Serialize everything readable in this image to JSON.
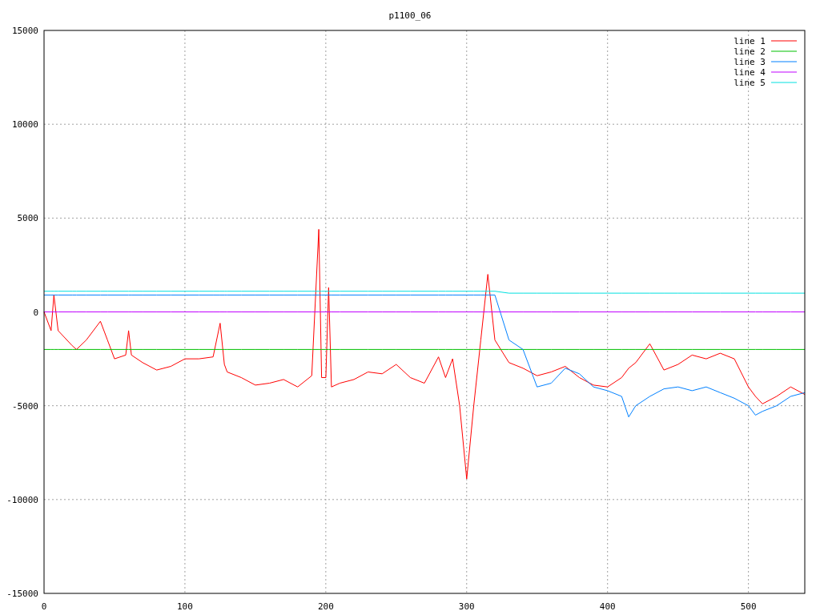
{
  "chart_data": {
    "type": "line",
    "title": "p1100_06",
    "x": [
      0,
      5,
      7,
      10,
      20,
      23,
      30,
      40,
      45,
      50,
      58,
      60,
      62,
      70,
      80,
      90,
      100,
      110,
      120,
      125,
      128,
      130,
      140,
      150,
      160,
      170,
      180,
      190,
      195,
      197,
      200,
      202,
      204,
      210,
      220,
      230,
      240,
      250,
      260,
      270,
      280,
      285,
      290,
      295,
      300,
      305,
      310,
      315,
      320,
      330,
      340,
      350,
      360,
      370,
      380,
      390,
      400,
      410,
      415,
      420,
      430,
      440,
      450,
      460,
      470,
      480,
      490,
      500,
      505,
      510,
      520,
      530,
      540
    ],
    "grid": true,
    "legend": true,
    "xlim": [
      0,
      540
    ],
    "ylim": [
      -15000,
      15000
    ],
    "xticks": [
      0,
      100,
      200,
      300,
      400,
      500
    ],
    "yticks": [
      -15000,
      -10000,
      -5000,
      0,
      5000,
      10000,
      15000
    ],
    "series": [
      {
        "name": "line 1",
        "color": "#ff0000",
        "values": [
          0,
          -1000,
          900,
          -1000,
          -1800,
          -2000,
          -1500,
          -500,
          -1500,
          -2500,
          -2300,
          -1000,
          -2300,
          -2700,
          -3100,
          -2900,
          -2500,
          -2500,
          -2400,
          -600,
          -2800,
          -3200,
          -3500,
          -3900,
          -3800,
          -3600,
          -4000,
          -3400,
          4400,
          -3500,
          -3500,
          1300,
          -4000,
          -3800,
          -3600,
          -3200,
          -3300,
          -2800,
          -3500,
          -3800,
          -2400,
          -3500,
          -2500,
          -5000,
          -8900,
          -5000,
          -1500,
          2000,
          -1500,
          -2700,
          -3000,
          -3400,
          -3200,
          -2900,
          -3500,
          -3900,
          -4000,
          -3500,
          -3000,
          -2700,
          -1700,
          -3100,
          -2800,
          -2300,
          -2500,
          -2200,
          -2500,
          -4000,
          -4500,
          -4900,
          -4500,
          -4000,
          -4400
        ]
      },
      {
        "name": "line 2",
        "color": "#00c000",
        "values": [
          -2000,
          -2000,
          -2000,
          -2000,
          -2000,
          -2000,
          -2000,
          -2000,
          -2000,
          -2000,
          -2000,
          -2000,
          -2000,
          -2000,
          -2000,
          -2000,
          -2000,
          -2000,
          -2000,
          -2000,
          -2000,
          -2000,
          -2000,
          -2000,
          -2000,
          -2000,
          -2000,
          -2000,
          -2000,
          -2000,
          -2000,
          -2000,
          -2000,
          -2000,
          -2000,
          -2000,
          -2000,
          -2000,
          -2000,
          -2000,
          -2000,
          -2000,
          -2000,
          -2000,
          -2000,
          -2000,
          -2000,
          -2000,
          -2000,
          -2000,
          -2000,
          -2000,
          -2000,
          -2000,
          -2000,
          -2000,
          -2000,
          -2000,
          -2000,
          -2000,
          -2000,
          -2000,
          -2000,
          -2000,
          -2000,
          -2000,
          -2000,
          -2000,
          -2000,
          -2000,
          -2000,
          -2000,
          -2000
        ]
      },
      {
        "name": "line 3",
        "color": "#0080ff",
        "values": [
          900,
          900,
          900,
          900,
          900,
          900,
          900,
          900,
          900,
          900,
          900,
          900,
          900,
          900,
          900,
          900,
          900,
          900,
          900,
          900,
          900,
          900,
          900,
          900,
          900,
          900,
          900,
          900,
          900,
          900,
          900,
          900,
          900,
          900,
          900,
          900,
          900,
          900,
          900,
          900,
          900,
          900,
          900,
          900,
          900,
          900,
          900,
          900,
          900,
          -1500,
          -2000,
          -4000,
          -3800,
          -3000,
          -3300,
          -4000,
          -4200,
          -4500,
          -5600,
          -5000,
          -4500,
          -4100,
          -4000,
          -4200,
          -4000,
          -4300,
          -4600,
          -5000,
          -5500,
          -5300,
          -5000,
          -4500,
          -4300
        ]
      },
      {
        "name": "line 4",
        "color": "#c000ff",
        "values": [
          0,
          0,
          0,
          0,
          0,
          0,
          0,
          0,
          0,
          0,
          0,
          0,
          0,
          0,
          0,
          0,
          0,
          0,
          0,
          0,
          0,
          0,
          0,
          0,
          0,
          0,
          0,
          0,
          0,
          0,
          0,
          0,
          0,
          0,
          0,
          0,
          0,
          0,
          0,
          0,
          0,
          0,
          0,
          0,
          0,
          0,
          0,
          0,
          0,
          0,
          0,
          0,
          0,
          0,
          0,
          0,
          0,
          0,
          0,
          0,
          0,
          0,
          0,
          0,
          0,
          0,
          0,
          0,
          0,
          0,
          0,
          0,
          0
        ]
      },
      {
        "name": "line 5",
        "color": "#00e0e0",
        "values": [
          1100,
          1100,
          1100,
          1100,
          1100,
          1100,
          1100,
          1100,
          1100,
          1100,
          1100,
          1100,
          1100,
          1100,
          1100,
          1100,
          1100,
          1100,
          1100,
          1100,
          1100,
          1100,
          1100,
          1100,
          1100,
          1100,
          1100,
          1100,
          1100,
          1100,
          1100,
          1100,
          1100,
          1100,
          1100,
          1100,
          1100,
          1100,
          1100,
          1100,
          1100,
          1100,
          1100,
          1100,
          1100,
          1100,
          1100,
          1100,
          1100,
          1000,
          1000,
          1000,
          1000,
          1000,
          1000,
          1000,
          1000,
          1000,
          1000,
          1000,
          1000,
          1000,
          1000,
          1000,
          1000,
          1000,
          1000,
          1000,
          1000,
          1000,
          1000,
          1000,
          1000
        ]
      }
    ]
  }
}
